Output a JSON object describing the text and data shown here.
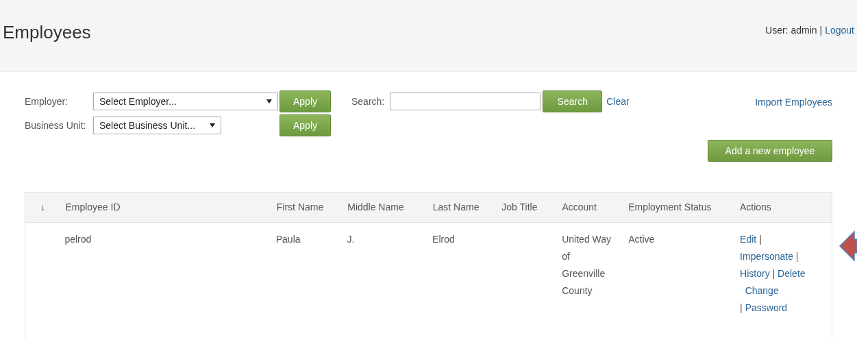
{
  "header": {
    "title": "Employees",
    "user_label": "User: admin",
    "separator": "|",
    "logout": "Logout"
  },
  "filters": {
    "employer": {
      "label": "Employer:",
      "value": "Select Employer...",
      "apply": "Apply"
    },
    "business_unit": {
      "label": "Business Unit:",
      "value": "Select Business Unit...",
      "apply": "Apply"
    },
    "search": {
      "label": "Search:",
      "button": "Search",
      "clear": "Clear"
    },
    "import": "Import Employees",
    "add": "Add a new employee"
  },
  "table": {
    "sort_marker": "↓",
    "columns": [
      "Employee ID",
      "First Name",
      "Middle Name",
      "Last Name",
      "Job Title",
      "Account",
      "Employment Status",
      "Actions"
    ],
    "rows": [
      {
        "cells": [
          "pelrod",
          "Paula",
          "J.",
          "Elrod",
          "",
          "United Way of Greenville County",
          "Active"
        ],
        "actions": [
          "Edit",
          "Impersonate",
          "History",
          "Delete",
          "Change Password"
        ],
        "action_separator": "|"
      }
    ]
  }
}
